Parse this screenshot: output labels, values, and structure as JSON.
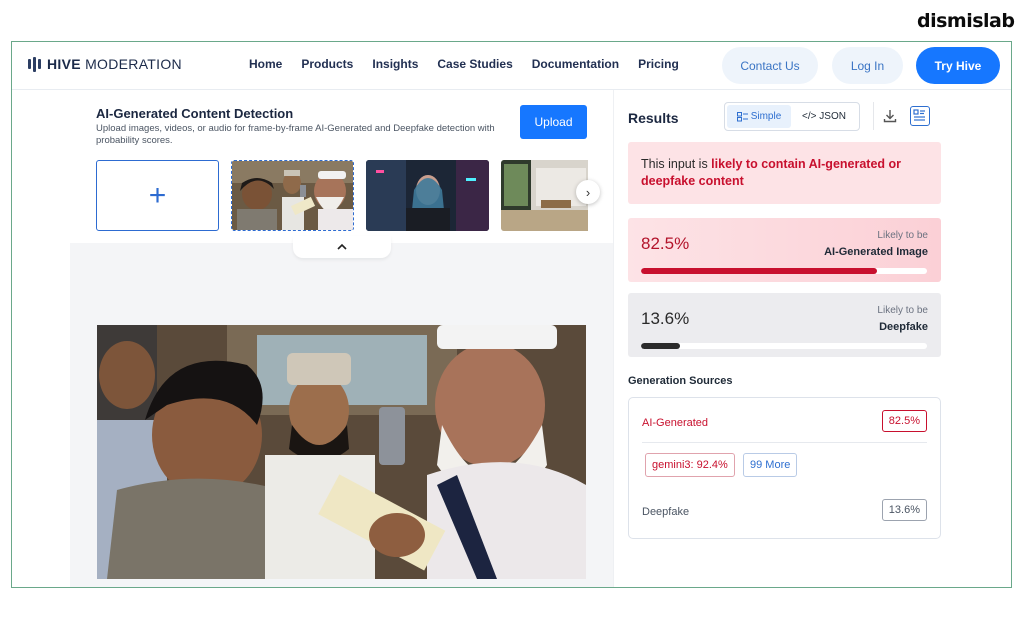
{
  "watermark": "dismislab",
  "nav": {
    "logo_bold": "HIVE",
    "logo_rest": "MODERATION",
    "links": [
      "Home",
      "Products",
      "Insights",
      "Case Studies",
      "Documentation",
      "Pricing"
    ],
    "contact": "Contact Us",
    "login": "Log In",
    "try": "Try Hive"
  },
  "detector": {
    "title": "AI-Generated Content Detection",
    "description": "Upload images, videos, or audio for frame-by-frame AI-Generated and Deepfake detection with probability scores.",
    "upload": "Upload",
    "add_symbol": "+"
  },
  "results": {
    "title": "Results",
    "simple": "Simple",
    "json": "</> JSON",
    "verdict_prefix": "This input is ",
    "verdict_highlight": "likely to contain AI-generated or deepfake content",
    "ai": {
      "pct": "82.5%",
      "likely": "Likely to be",
      "label": "AI-Generated Image",
      "fraction": 0.825
    },
    "deepfake": {
      "pct": "13.6%",
      "likely": "Likely to be",
      "label": "Deepfake",
      "fraction": 0.136
    },
    "sources_title": "Generation Sources",
    "sources": {
      "ai_label": "AI-Generated",
      "ai_value": "82.5%",
      "chip_model": "gemini3: 92.4%",
      "chip_more": "99 More",
      "df_label": "Deepfake",
      "df_value": "13.6%"
    }
  },
  "colors": {
    "accent": "#1677ff",
    "alert": "#c8102e",
    "alert_bg": "#fde3e6"
  },
  "icons": [
    "logo-bars-icon",
    "plus-icon",
    "chevron-right-icon",
    "chevron-up-icon",
    "list-icon",
    "download-icon",
    "layout-icon"
  ]
}
